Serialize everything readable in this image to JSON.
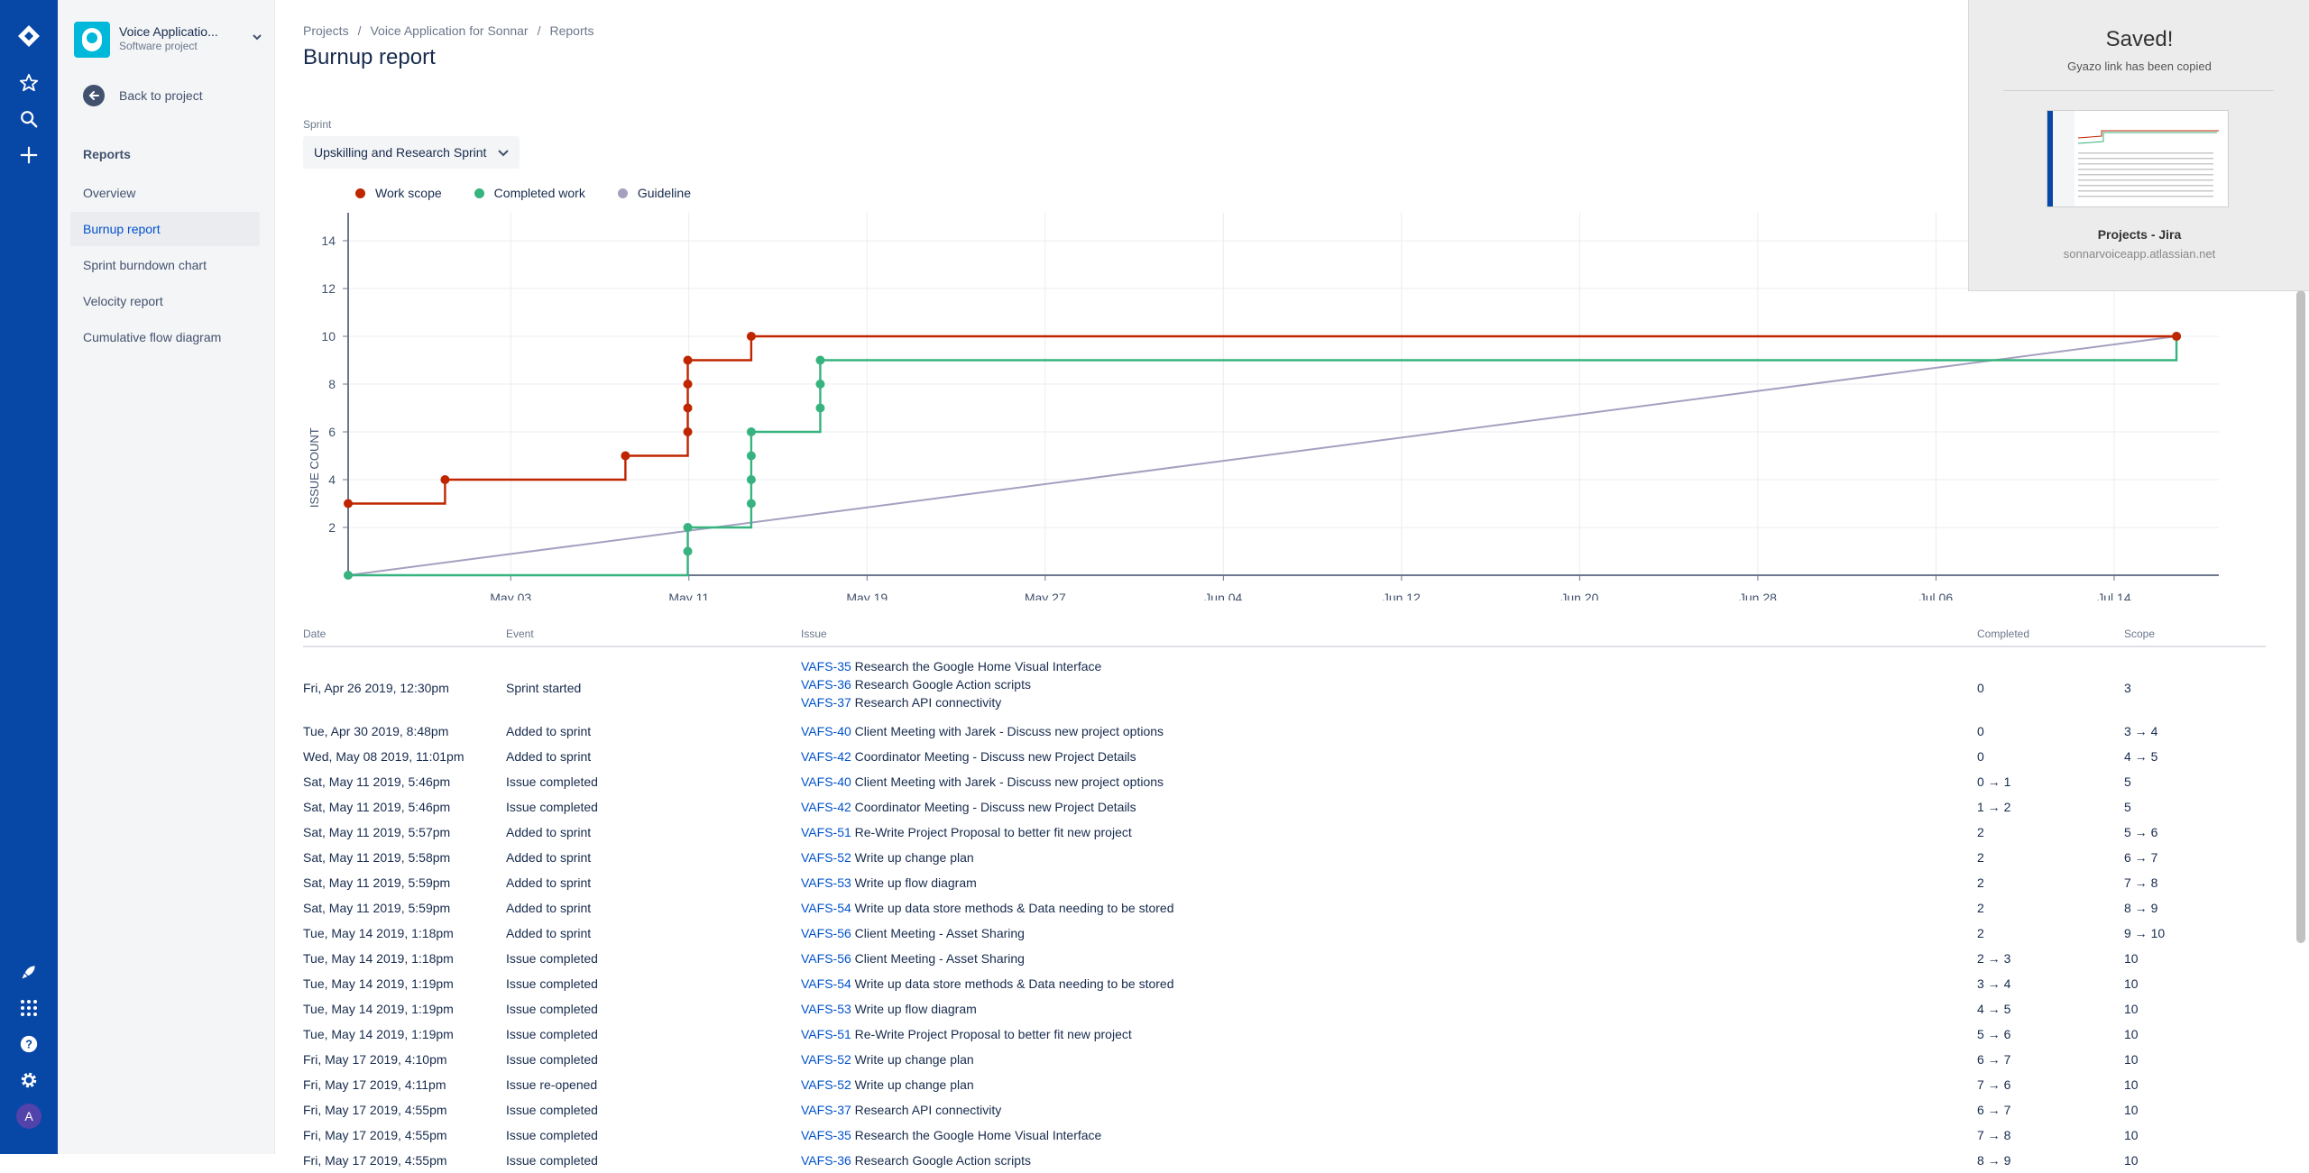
{
  "colors": {
    "nav_bg": "#0747a6",
    "work_scope": "#bf2600",
    "completed_work": "#36b37e",
    "guideline": "#a5a0c0",
    "link": "#0052cc"
  },
  "global_nav": {
    "icons": [
      "jira-logo-icon",
      "star-icon",
      "search-icon",
      "plus-icon",
      "rocket-icon",
      "apps-grid-icon",
      "help-icon",
      "gear-icon"
    ],
    "avatar_initial": "A"
  },
  "sidebar": {
    "project_name": "Voice Applicatio...",
    "project_type": "Software project",
    "back_label": "Back to project",
    "section_title": "Reports",
    "items": [
      {
        "label": "Overview",
        "active": false
      },
      {
        "label": "Burnup report",
        "active": true
      },
      {
        "label": "Sprint burndown chart",
        "active": false
      },
      {
        "label": "Velocity report",
        "active": false
      },
      {
        "label": "Cumulative flow diagram",
        "active": false
      }
    ]
  },
  "breadcrumb": [
    "Projects",
    "Voice Application for Sonnar",
    "Reports"
  ],
  "page_title": "Burnup report",
  "sprint": {
    "label": "Sprint",
    "value": "Upskilling and Research Sprint"
  },
  "chart_data": {
    "type": "line",
    "title": "",
    "ylabel": "ISSUE COUNT",
    "xlabel": "",
    "ylim": [
      0,
      15
    ],
    "yticks": [
      2,
      4,
      6,
      8,
      10,
      12,
      14
    ],
    "xrange_days": [
      0,
      84
    ],
    "xticks": [
      {
        "label": "May 03",
        "day": 7.3
      },
      {
        "label": "May 11",
        "day": 15.3
      },
      {
        "label": "May 19",
        "day": 23.3
      },
      {
        "label": "May 27",
        "day": 31.3
      },
      {
        "label": "Jun 04",
        "day": 39.3
      },
      {
        "label": "Jun 12",
        "day": 47.3
      },
      {
        "label": "Jun 20",
        "day": 55.3
      },
      {
        "label": "Jun 28",
        "day": 63.3
      },
      {
        "label": "Jul 06",
        "day": 71.3
      },
      {
        "label": "Jul 14",
        "day": 79.3
      }
    ],
    "legend": [
      "Work scope",
      "Completed work",
      "Guideline"
    ],
    "series": [
      {
        "name": "Work scope",
        "steps": [
          [
            0,
            3
          ],
          [
            4.35,
            4
          ],
          [
            12.45,
            5
          ],
          [
            15.25,
            6
          ],
          [
            15.25,
            7
          ],
          [
            15.25,
            8
          ],
          [
            15.25,
            9
          ],
          [
            18.1,
            10
          ],
          [
            82.1,
            10
          ]
        ]
      },
      {
        "name": "Completed work",
        "steps": [
          [
            0,
            0
          ],
          [
            15.25,
            1
          ],
          [
            15.25,
            2
          ],
          [
            18.1,
            3
          ],
          [
            18.1,
            4
          ],
          [
            18.1,
            5
          ],
          [
            18.1,
            6
          ],
          [
            21.2,
            7
          ],
          [
            21.2,
            8
          ],
          [
            21.2,
            9
          ],
          [
            82.1,
            10
          ]
        ]
      },
      {
        "name": "Guideline",
        "points": [
          [
            0,
            0
          ],
          [
            82.1,
            10
          ]
        ]
      }
    ],
    "grid": true
  },
  "table": {
    "headers": {
      "date": "Date",
      "event": "Event",
      "issue": "Issue",
      "completed": "Completed",
      "scope": "Scope"
    },
    "rows": [
      {
        "date": "Fri, Apr 26 2019, 12:30pm",
        "event": "Sprint started",
        "issues": [
          {
            "key": "VAFS-35",
            "summary": "Research the Google Home Visual Interface"
          },
          {
            "key": "VAFS-36",
            "summary": "Research Google Action scripts"
          },
          {
            "key": "VAFS-37",
            "summary": "Research API connectivity"
          }
        ],
        "completed": "0",
        "scope": "3"
      },
      {
        "date": "Tue, Apr 30 2019, 8:48pm",
        "event": "Added to sprint",
        "issues": [
          {
            "key": "VAFS-40",
            "summary": "Client Meeting with Jarek - Discuss new project options"
          }
        ],
        "completed": "0",
        "scope": "3 → 4"
      },
      {
        "date": "Wed, May 08 2019, 11:01pm",
        "event": "Added to sprint",
        "issues": [
          {
            "key": "VAFS-42",
            "summary": "Coordinator Meeting - Discuss new Project Details"
          }
        ],
        "completed": "0",
        "scope": "4 → 5"
      },
      {
        "date": "Sat, May 11 2019, 5:46pm",
        "event": "Issue completed",
        "issues": [
          {
            "key": "VAFS-40",
            "summary": "Client Meeting with Jarek - Discuss new project options"
          }
        ],
        "completed": "0 → 1",
        "scope": "5"
      },
      {
        "date": "Sat, May 11 2019, 5:46pm",
        "event": "Issue completed",
        "issues": [
          {
            "key": "VAFS-42",
            "summary": "Coordinator Meeting - Discuss new Project Details"
          }
        ],
        "completed": "1 → 2",
        "scope": "5"
      },
      {
        "date": "Sat, May 11 2019, 5:57pm",
        "event": "Added to sprint",
        "issues": [
          {
            "key": "VAFS-51",
            "summary": "Re-Write Project Proposal to better fit new project"
          }
        ],
        "completed": "2",
        "scope": "5 → 6"
      },
      {
        "date": "Sat, May 11 2019, 5:58pm",
        "event": "Added to sprint",
        "issues": [
          {
            "key": "VAFS-52",
            "summary": "Write up change plan"
          }
        ],
        "completed": "2",
        "scope": "6 → 7"
      },
      {
        "date": "Sat, May 11 2019, 5:59pm",
        "event": "Added to sprint",
        "issues": [
          {
            "key": "VAFS-53",
            "summary": "Write up flow diagram"
          }
        ],
        "completed": "2",
        "scope": "7 → 8"
      },
      {
        "date": "Sat, May 11 2019, 5:59pm",
        "event": "Added to sprint",
        "issues": [
          {
            "key": "VAFS-54",
            "summary": "Write up data store methods & Data needing to be stored"
          }
        ],
        "completed": "2",
        "scope": "8 → 9"
      },
      {
        "date": "Tue, May 14 2019, 1:18pm",
        "event": "Added to sprint",
        "issues": [
          {
            "key": "VAFS-56",
            "summary": "Client Meeting - Asset Sharing"
          }
        ],
        "completed": "2",
        "scope": "9 → 10"
      },
      {
        "date": "Tue, May 14 2019, 1:18pm",
        "event": "Issue completed",
        "issues": [
          {
            "key": "VAFS-56",
            "summary": "Client Meeting - Asset Sharing"
          }
        ],
        "completed": "2 → 3",
        "scope": "10"
      },
      {
        "date": "Tue, May 14 2019, 1:19pm",
        "event": "Issue completed",
        "issues": [
          {
            "key": "VAFS-54",
            "summary": "Write up data store methods & Data needing to be stored"
          }
        ],
        "completed": "3 → 4",
        "scope": "10"
      },
      {
        "date": "Tue, May 14 2019, 1:19pm",
        "event": "Issue completed",
        "issues": [
          {
            "key": "VAFS-53",
            "summary": "Write up flow diagram"
          }
        ],
        "completed": "4 → 5",
        "scope": "10"
      },
      {
        "date": "Tue, May 14 2019, 1:19pm",
        "event": "Issue completed",
        "issues": [
          {
            "key": "VAFS-51",
            "summary": "Re-Write Project Proposal to better fit new project"
          }
        ],
        "completed": "5 → 6",
        "scope": "10"
      },
      {
        "date": "Fri, May 17 2019, 4:10pm",
        "event": "Issue completed",
        "issues": [
          {
            "key": "VAFS-52",
            "summary": "Write up change plan"
          }
        ],
        "completed": "6 → 7",
        "scope": "10"
      },
      {
        "date": "Fri, May 17 2019, 4:11pm",
        "event": "Issue re-opened",
        "issues": [
          {
            "key": "VAFS-52",
            "summary": "Write up change plan"
          }
        ],
        "completed": "7 → 6",
        "scope": "10"
      },
      {
        "date": "Fri, May 17 2019, 4:55pm",
        "event": "Issue completed",
        "issues": [
          {
            "key": "VAFS-37",
            "summary": "Research API connectivity"
          }
        ],
        "completed": "6 → 7",
        "scope": "10"
      },
      {
        "date": "Fri, May 17 2019, 4:55pm",
        "event": "Issue completed",
        "issues": [
          {
            "key": "VAFS-35",
            "summary": "Research the Google Home Visual Interface"
          }
        ],
        "completed": "7 → 8",
        "scope": "10"
      },
      {
        "date": "Fri, May 17 2019, 4:55pm",
        "event": "Issue completed",
        "issues": [
          {
            "key": "VAFS-36",
            "summary": "Research Google Action scripts"
          }
        ],
        "completed": "8 → 9",
        "scope": "10"
      }
    ]
  },
  "gyazo": {
    "saved": "Saved!",
    "copied": "Gyazo link has been copied",
    "page_title": "Projects - Jira",
    "url": "sonnarvoiceapp.atlassian.net"
  }
}
